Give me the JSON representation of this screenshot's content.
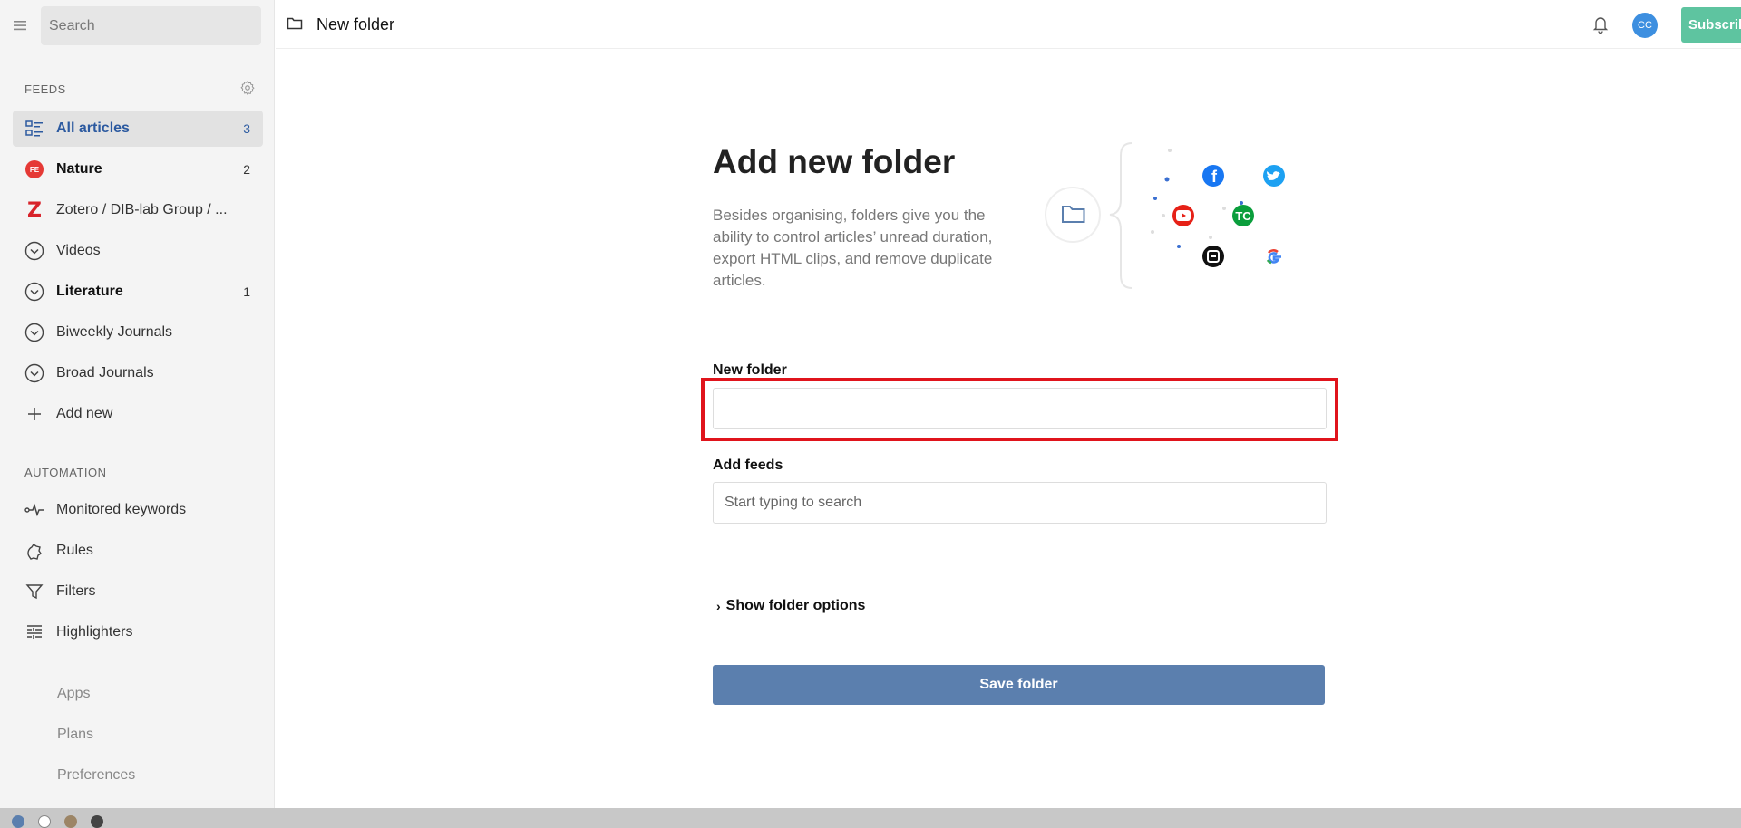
{
  "sidebar": {
    "search_placeholder": "Search",
    "feeds_label": "FEEDS",
    "feeds": [
      {
        "label": "All articles",
        "count": "3"
      },
      {
        "label": "Nature",
        "count": "2",
        "badge": "FE"
      },
      {
        "label": "Zotero / DIB-lab Group / ..."
      },
      {
        "label": "Videos"
      },
      {
        "label": "Literature",
        "count": "1"
      },
      {
        "label": "Biweekly Journals"
      },
      {
        "label": "Broad Journals"
      },
      {
        "label": "Add new"
      }
    ],
    "automation_label": "AUTOMATION",
    "automation": [
      {
        "label": "Monitored keywords"
      },
      {
        "label": "Rules"
      },
      {
        "label": "Filters"
      },
      {
        "label": "Highlighters"
      }
    ],
    "footer": [
      {
        "label": "Apps"
      },
      {
        "label": "Plans"
      },
      {
        "label": "Preferences"
      }
    ]
  },
  "topbar": {
    "title": "New folder",
    "avatar_initials": "CC",
    "subscribe_label": "Subscribe"
  },
  "main": {
    "heading": "Add new folder",
    "description": "Besides organising, folders give you the ability to control articles’ unread duration, export HTML clips, and remove duplicate articles.",
    "folder_label": "New folder",
    "folder_value": "",
    "feeds_label": "Add feeds",
    "feeds_placeholder": "Start typing to search",
    "options_label": "Show folder options",
    "save_label": "Save folder"
  },
  "colors": {
    "accent": "#2c5aa0",
    "save_button": "#5b7fae",
    "subscribe": "#5ec4a0",
    "highlight": "#e0141c"
  },
  "icons": [
    "menu-icon",
    "gear-icon",
    "all-articles-icon",
    "zotero-icon",
    "chevron-circle-icon",
    "plus-icon",
    "pulse-icon",
    "rules-icon",
    "filter-icon",
    "highlighter-icon",
    "folder-icon",
    "bell-icon",
    "facebook-icon",
    "twitter-icon",
    "youtube-icon",
    "techcrunch-icon",
    "engadget-icon",
    "google-icon"
  ]
}
